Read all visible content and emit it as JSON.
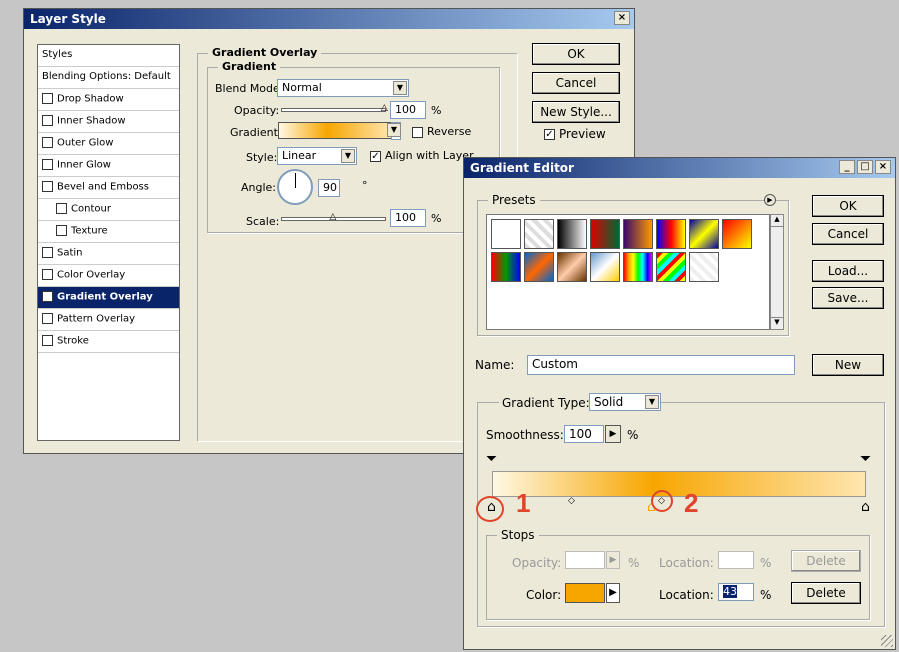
{
  "layer_style": {
    "title": "Layer Style",
    "close": "×",
    "list": [
      {
        "label": "Styles",
        "checkbox": false,
        "checked": false,
        "indent": false,
        "selected": false
      },
      {
        "label": "Blending Options: Default",
        "checkbox": false,
        "checked": false,
        "indent": false,
        "selected": false
      },
      {
        "label": "Drop Shadow",
        "checkbox": true,
        "checked": false,
        "indent": false,
        "selected": false
      },
      {
        "label": "Inner Shadow",
        "checkbox": true,
        "checked": false,
        "indent": false,
        "selected": false
      },
      {
        "label": "Outer Glow",
        "checkbox": true,
        "checked": false,
        "indent": false,
        "selected": false
      },
      {
        "label": "Inner Glow",
        "checkbox": true,
        "checked": false,
        "indent": false,
        "selected": false
      },
      {
        "label": "Bevel and Emboss",
        "checkbox": true,
        "checked": false,
        "indent": false,
        "selected": false
      },
      {
        "label": "Contour",
        "checkbox": true,
        "checked": false,
        "indent": true,
        "selected": false
      },
      {
        "label": "Texture",
        "checkbox": true,
        "checked": false,
        "indent": true,
        "selected": false
      },
      {
        "label": "Satin",
        "checkbox": true,
        "checked": false,
        "indent": false,
        "selected": false
      },
      {
        "label": "Color Overlay",
        "checkbox": true,
        "checked": false,
        "indent": false,
        "selected": false
      },
      {
        "label": "Gradient Overlay",
        "checkbox": true,
        "checked": true,
        "indent": false,
        "selected": true
      },
      {
        "label": "Pattern Overlay",
        "checkbox": true,
        "checked": false,
        "indent": false,
        "selected": false
      },
      {
        "label": "Stroke",
        "checkbox": true,
        "checked": false,
        "indent": false,
        "selected": false
      }
    ],
    "section_title": "Gradient Overlay",
    "group_title": "Gradient",
    "blend_mode_label": "Blend Mode:",
    "blend_mode_value": "Normal",
    "opacity_label": "Opacity:",
    "opacity_value": "100",
    "opacity_fraction": 1.0,
    "percent": "%",
    "gradient_label": "Gradient:",
    "reverse_label": "Reverse",
    "style_label": "Style:",
    "style_value": "Linear",
    "align_label": "Align with Layer",
    "angle_label": "Angle:",
    "angle_value": "90",
    "degree": "°",
    "scale_label": "Scale:",
    "scale_value": "100",
    "scale_fraction": 0.5,
    "ok": "OK",
    "cancel": "Cancel",
    "new_style": "New Style...",
    "preview": "Preview"
  },
  "gradient_editor": {
    "title": "Gradient Editor",
    "min_btn": "_",
    "max_btn": "□",
    "close_btn": "×",
    "presets_label": "Presets",
    "ok": "OK",
    "cancel": "Cancel",
    "load": "Load...",
    "save": "Save...",
    "name_label": "Name:",
    "name_value": "Custom",
    "new_btn": "New",
    "gradient_type_label": "Gradient Type:",
    "gradient_type_value": "Solid",
    "smoothness_label": "Smoothness:",
    "smoothness_value": "100",
    "percent": "%",
    "stops_label": "Stops",
    "opacity_label": "Opacity:",
    "location_label": "Location:",
    "delete_btn": "Delete",
    "color_label": "Color:",
    "color_location_value": "43",
    "color_value": "#f7a600",
    "presets": [
      "linear-gradient(135deg,#ffffff,#ffffff)",
      "repeating-linear-gradient(45deg,#ddd 0 4px,#fff 4px 8px)",
      "linear-gradient(90deg,#000,#fff)",
      "linear-gradient(90deg,#d00,#063)",
      "linear-gradient(90deg,#3a0a6a,#f90)",
      "linear-gradient(90deg,#00f,#f00,#ff0)",
      "linear-gradient(135deg,#00a,#ff0 50%,#00a)",
      "linear-gradient(135deg,#f00,#ff0)",
      "linear-gradient(90deg,#f00,#090,#00f)",
      "linear-gradient(135deg,#06c,#f60,#06c)",
      "linear-gradient(135deg,#630,#fca,#630)",
      "linear-gradient(135deg,#69c,#fff,#fc0)",
      "linear-gradient(90deg,red,orange,yellow,lime,cyan,blue,magenta)",
      "repeating-linear-gradient(135deg,red 0 4px,yellow 4px 8px,lime 8px 12px,cyan 12px 16px)",
      "repeating-linear-gradient(45deg,#eee 0 4px,#fff 4px 8px)"
    ],
    "gradient_colors": [
      "#fff8e5",
      "#f7a600",
      "#ffe6b0"
    ],
    "annotations": [
      "1",
      "2"
    ]
  }
}
